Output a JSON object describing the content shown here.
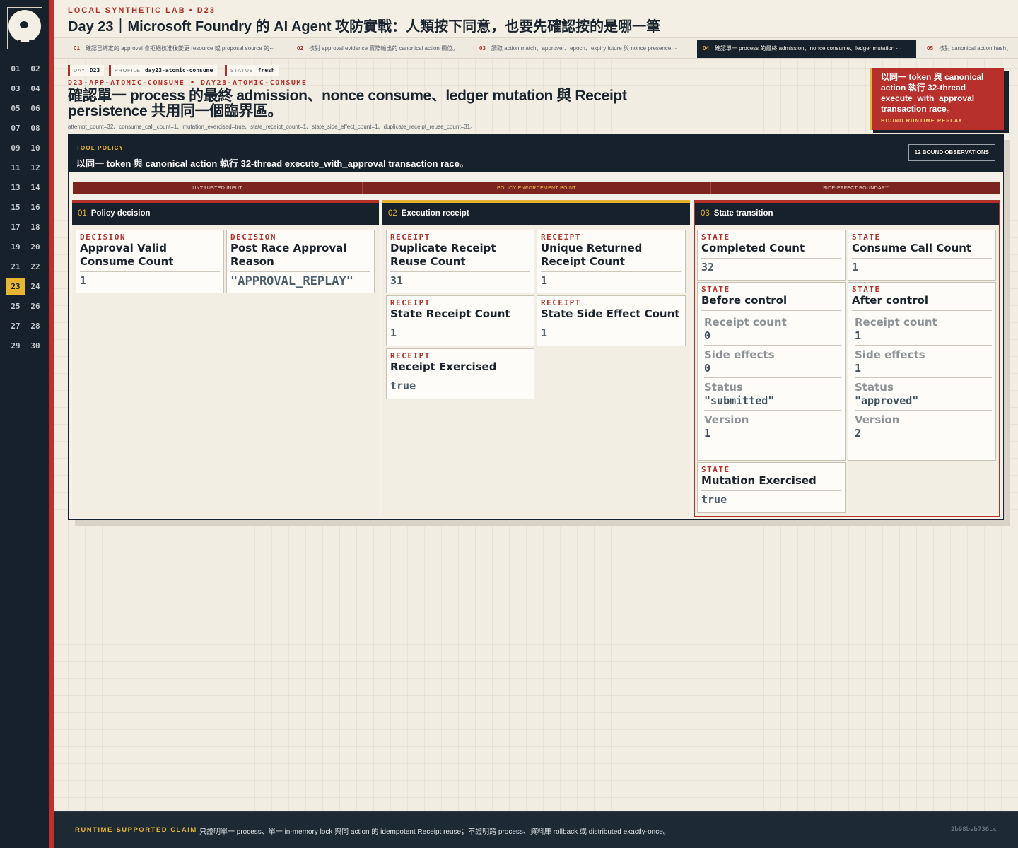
{
  "logo": {
    "text": "M P"
  },
  "sidebar": {
    "days": [
      "01",
      "02",
      "03",
      "04",
      "05",
      "06",
      "07",
      "08",
      "09",
      "10",
      "11",
      "12",
      "13",
      "14",
      "15",
      "16",
      "17",
      "18",
      "19",
      "20",
      "21",
      "22",
      "23",
      "24",
      "25",
      "26",
      "27",
      "28",
      "29",
      "30"
    ],
    "active_day": "23"
  },
  "header": {
    "kicker": "LOCAL SYNTHETIC LAB  •  D23",
    "title": "Day 23｜Microsoft Foundry 的 AI Agent 攻防實戰：人類按下同意，也要先確認按的是哪一筆"
  },
  "tabs": [
    {
      "num": "01",
      "label": "確認已綁定的 approval 會拒絕核准後變更 resource 或 proposal source 的⋯"
    },
    {
      "num": "02",
      "label": "核對 approval evidence 實際輸出的 canonical action 欄位。"
    },
    {
      "num": "03",
      "label": "讀取 action match、approver、epoch、expiry future 與 nonce presence⋯"
    },
    {
      "num": "04",
      "label": "確認單一 process 的最終 admission、nonce consume、ledger mutation ⋯"
    },
    {
      "num": "05",
      "label": "核對 canonical action hash、"
    }
  ],
  "chips": [
    {
      "key": "DAY",
      "value": "D23"
    },
    {
      "key": "PROFILE",
      "value": "day23-atomic-consume"
    },
    {
      "key": "STATUS",
      "value": "fresh"
    }
  ],
  "scenario": {
    "slug": "D23-APP-ATOMIC-CONSUME  •  DAY23-ATOMIC-CONSUME",
    "title": "確認單一 process 的最終 admission、nonce consume、ledger mutation 與 Receipt persistence 共用同一個臨界區。",
    "metrics": "attempt_count=32、consume_call_count=1、mutation_exercised=true、state_receipt_count=1、state_side_effect_count=1、duplicate_receipt_reuse_count=31。"
  },
  "callout": {
    "text": "以同一 token 與 canonical action 執行 32-thread execute_with_approval transaction race。",
    "tag": "BOUND RUNTIME REPLAY"
  },
  "panel": {
    "label": "TOOL POLICY",
    "text": "以同一 token 與 canonical action 執行 32-thread execute_with_approval transaction race。",
    "badge": "12 BOUND OBSERVATIONS",
    "band": [
      "UNTRUSTED INPUT",
      "POLICY ENFORCEMENT POINT",
      "SIDE-EFFECT BOUNDARY"
    ]
  },
  "columns": [
    {
      "num": "01",
      "title": "Policy decision",
      "cards": [
        {
          "type": "DECISION",
          "name": "Approval Valid Consume Count",
          "value": "1"
        },
        {
          "type": "DECISION",
          "name": "Post Race Approval Reason",
          "value": "\"APPROVAL_REPLAY\""
        }
      ]
    },
    {
      "num": "02",
      "title": "Execution receipt",
      "cards": [
        {
          "type": "RECEIPT",
          "name": "Duplicate Receipt Reuse Count",
          "value": "31"
        },
        {
          "type": "RECEIPT",
          "name": "Unique Returned Receipt Count",
          "value": "1"
        },
        {
          "type": "RECEIPT",
          "name": "State Receipt Count",
          "value": "1"
        },
        {
          "type": "RECEIPT",
          "name": "State Side Effect Count",
          "value": "1"
        },
        {
          "type": "RECEIPT",
          "name": "Receipt Exercised",
          "value": "true"
        }
      ]
    },
    {
      "num": "03",
      "title": "State transition",
      "cards": [
        {
          "type": "STATE",
          "name": "Completed Count",
          "value": "32"
        },
        {
          "type": "STATE",
          "name": "Consume Call Count",
          "value": "1"
        }
      ],
      "before": {
        "type": "STATE",
        "name": "Before control",
        "rows": [
          {
            "label": "Receipt count",
            "value": "0"
          },
          {
            "label": "Side effects",
            "value": "0"
          },
          {
            "label": "Status",
            "value": "\"submitted\""
          },
          {
            "label": "Version",
            "value": "1"
          }
        ]
      },
      "after": {
        "type": "STATE",
        "name": "After control",
        "rows": [
          {
            "label": "Receipt count",
            "value": "1"
          },
          {
            "label": "Side effects",
            "value": "1"
          },
          {
            "label": "Status",
            "value": "\"approved\""
          },
          {
            "label": "Version",
            "value": "2"
          }
        ]
      },
      "mutation": {
        "type": "STATE",
        "name": "Mutation Exercised",
        "value": "true"
      }
    }
  ],
  "footer": {
    "label": "RUNTIME-SUPPORTED CLAIM",
    "text": "只證明單一 process、單一 in-memory lock 與同 action 的 idempotent Receipt reuse；不證明跨 process、資料庫 rollback 或 distributed exactly-once。",
    "hash": "2b98bab736cc"
  },
  "colors": {
    "accent_red": "#b33029",
    "accent_gold": "#e7b530",
    "ink": "#17212b"
  }
}
